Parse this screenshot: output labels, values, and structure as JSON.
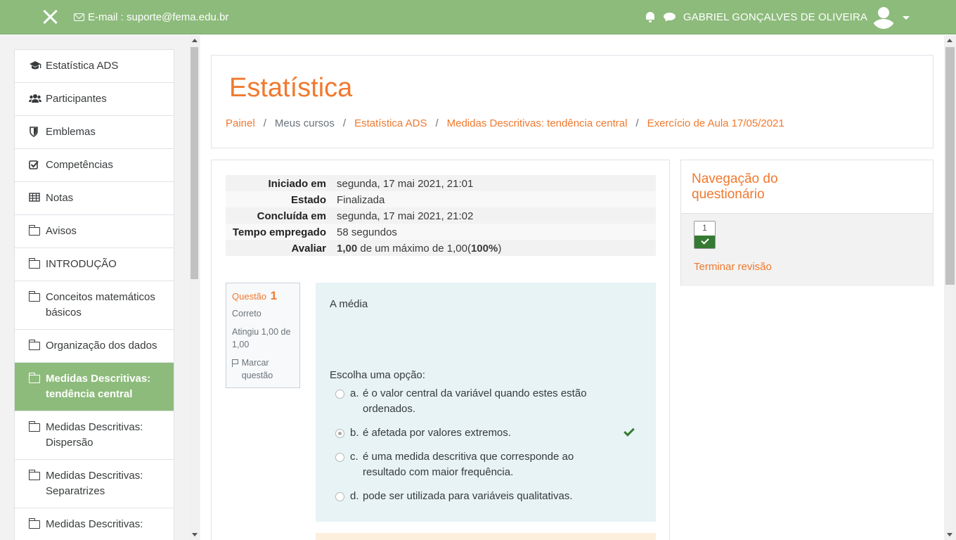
{
  "navbar": {
    "email": "E-mail : suporte@fema.edu.br",
    "user_name": "GABRIEL GONÇALVES DE OLIVEIRA",
    "color": "#8dbb7b"
  },
  "drawer": {
    "items": [
      {
        "label": "Estatística ADS",
        "icon": "graduation-cap-icon"
      },
      {
        "label": "Participantes",
        "icon": "users-icon"
      },
      {
        "label": "Emblemas",
        "icon": "shield-icon"
      },
      {
        "label": "Competências",
        "icon": "checkbox-icon"
      },
      {
        "label": "Notas",
        "icon": "table-icon"
      },
      {
        "label": "Avisos",
        "icon": "folder-icon"
      },
      {
        "label": "INTRODUÇÃO",
        "icon": "folder-icon"
      },
      {
        "label": "Conceitos matemáticos básicos",
        "icon": "folder-icon"
      },
      {
        "label": "Organização dos dados",
        "icon": "folder-icon"
      },
      {
        "label": "Medidas Descritivas: tendência central",
        "icon": "folder-icon",
        "active": true
      },
      {
        "label": "Medidas Descritivas: Dispersão",
        "icon": "folder-icon"
      },
      {
        "label": "Medidas Descritivas: Separatrizes",
        "icon": "folder-icon"
      },
      {
        "label": "Medidas Descritivas:",
        "icon": "folder-icon"
      }
    ]
  },
  "header": {
    "title": "Estatística",
    "breadcrumb": {
      "painel": "Painel",
      "meus_cursos": "Meus cursos",
      "curso": "Estatística ADS",
      "secao": "Medidas Descritivas: tendência central",
      "atividade": "Exercício de Aula 17/05/2021"
    }
  },
  "summary": {
    "iniciado_label": "Iniciado em",
    "iniciado_value": "segunda, 17 mai 2021, 21:01",
    "estado_label": "Estado",
    "estado_value": "Finalizada",
    "concluida_label": "Concluída em",
    "concluida_value": "segunda, 17 mai 2021, 21:02",
    "tempo_label": "Tempo empregado",
    "tempo_value": "58 segundos",
    "avaliar_label": "Avaliar",
    "avaliar_score": "1,00",
    "avaliar_mid": " de um máximo de 1,00(",
    "avaliar_pct": "100%",
    "avaliar_end": ")"
  },
  "question": {
    "label": "Questão",
    "number": "1",
    "state": "Correto",
    "grade": "Atingiu 1,00 de 1,00",
    "flag": "Marcar questão",
    "text": "A média",
    "prompt": "Escolha uma opção:",
    "options": [
      {
        "letter": "a.",
        "line1": "é o valor central da variável quando estes estão",
        "line2": "ordenados."
      },
      {
        "letter": "b.",
        "line1": "é afetada por valores extremos.",
        "line2": "",
        "selected": true,
        "correct": true
      },
      {
        "letter": "c.",
        "line1": "é uma medida descritiva que corresponde ao",
        "line2": "resultado com maior frequência."
      },
      {
        "letter": "d.",
        "line1": "pode ser utilizada para variáveis qualitativas.",
        "line2": ""
      }
    ]
  },
  "quiz_nav": {
    "title": "Navegação do questionário",
    "question_button": "1",
    "finish": "Terminar revisão"
  },
  "colors": {
    "accent": "#f0792f",
    "brand": "#8dbb7b",
    "correct": "#357a32"
  }
}
